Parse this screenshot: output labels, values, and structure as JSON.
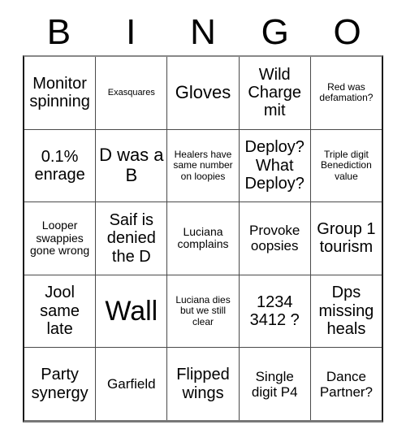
{
  "header": {
    "letters": [
      "B",
      "I",
      "N",
      "G",
      "O"
    ]
  },
  "grid": {
    "columns": 5,
    "rows": 5,
    "cells": [
      [
        {
          "text": "Monitor spinning",
          "size": "fs-md"
        },
        {
          "text": "Exasquares",
          "size": "fs-tiny"
        },
        {
          "text": "Gloves",
          "size": "fs-lg"
        },
        {
          "text": "Wild Charge mit",
          "size": "fs-md"
        },
        {
          "text": "Red was defamation?",
          "size": "fs-xxs"
        }
      ],
      [
        {
          "text": "0.1% enrage",
          "size": "fs-md"
        },
        {
          "text": "D was a B",
          "size": "fs-lg"
        },
        {
          "text": "Healers have same number on loopies",
          "size": "fs-xxs"
        },
        {
          "text": "Deploy? What Deploy?",
          "size": "fs-md"
        },
        {
          "text": "Triple digit Benediction value",
          "size": "fs-xxs"
        }
      ],
      [
        {
          "text": "Looper swappies gone wrong",
          "size": "fs-xs"
        },
        {
          "text": "Saif is denied the D",
          "size": "fs-md"
        },
        {
          "text": "Luciana complains",
          "size": "fs-xs"
        },
        {
          "text": "Provoke oopsies",
          "size": "fs-sm"
        },
        {
          "text": "Group 1 tourism",
          "size": "fs-md"
        }
      ],
      [
        {
          "text": "Jool same late",
          "size": "fs-md"
        },
        {
          "text": "Wall",
          "size": "fs-xl"
        },
        {
          "text": "Luciana dies but we still clear",
          "size": "fs-xxs"
        },
        {
          "text": "1234 3412 ?",
          "size": "fs-md"
        },
        {
          "text": "Dps missing heals",
          "size": "fs-md"
        }
      ],
      [
        {
          "text": "Party synergy",
          "size": "fs-md"
        },
        {
          "text": "Garfield",
          "size": "fs-sm"
        },
        {
          "text": "Flipped wings",
          "size": "fs-md"
        },
        {
          "text": "Single digit P4",
          "size": "fs-sm"
        },
        {
          "text": "Dance Partner?",
          "size": "fs-sm"
        }
      ]
    ]
  },
  "colors": {
    "background": "#ffffff",
    "text": "#000000",
    "grid_line": "#4a4a4a",
    "outer_border": "#1a1a1a"
  }
}
